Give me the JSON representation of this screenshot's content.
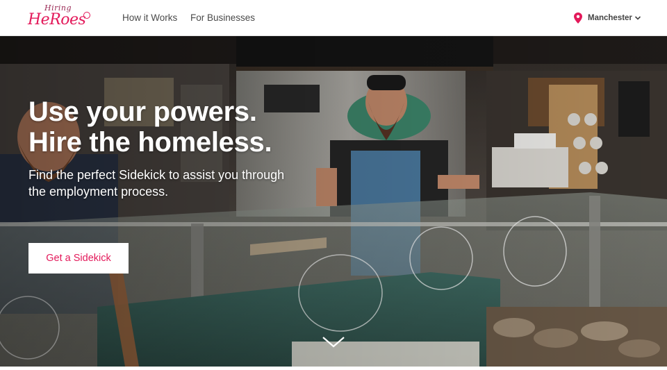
{
  "brand": {
    "logo_top": "Hiring",
    "logo_main": "HeRoes"
  },
  "nav": {
    "links": [
      "How it Works",
      "For Businesses"
    ],
    "location": {
      "label": "Manchester",
      "icon": "map-pin-icon"
    }
  },
  "hero": {
    "headline": [
      "Use your powers.",
      "Hire the homeless."
    ],
    "subtext": "Find the perfect Sidekick to assist you through the employment process.",
    "cta_label": "Get a Sidekick",
    "scroll_icon": "chevron-down-icon"
  },
  "colors": {
    "accent": "#e3195a",
    "nav_text": "#4a4a4a",
    "hero_text": "#ffffff"
  }
}
